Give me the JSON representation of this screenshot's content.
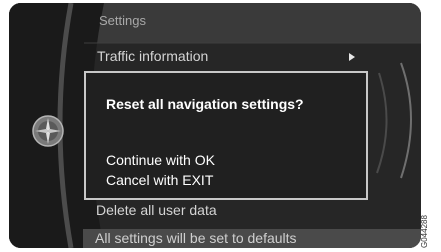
{
  "header": {
    "title": "Settings"
  },
  "menu": {
    "traffic_label": "Traffic information",
    "delete_label": "Delete all user data"
  },
  "dialog": {
    "title": "Reset all navigation settings?",
    "continue_label": "Continue with OK",
    "cancel_label": "Cancel with EXIT"
  },
  "status": {
    "text": "All settings will be set to defaults"
  },
  "figure_id": "G044288",
  "colors": {
    "screen_background": "#262626",
    "dialog_border": "#c8c8c8",
    "status_bar": "#4a4a4a"
  },
  "icons": {
    "nav_icon": "compass-icon",
    "submenu_icon": "arrow-right-icon"
  }
}
